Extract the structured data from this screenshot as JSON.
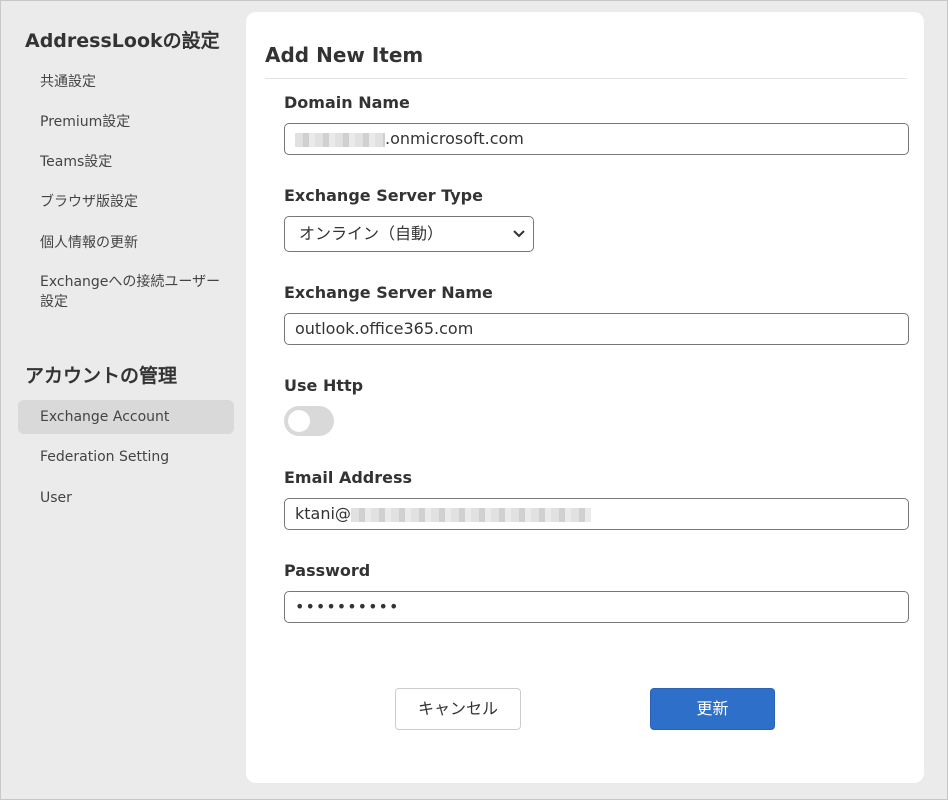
{
  "sidebar": {
    "settings_heading": "AddressLookの設定",
    "settings_items": [
      {
        "label": "共通設定"
      },
      {
        "label": "Premium設定"
      },
      {
        "label": "Teams設定"
      },
      {
        "label": "ブラウザ版設定"
      },
      {
        "label": "個人情報の更新"
      },
      {
        "label": "Exchangeへの接続ユーザー設定"
      }
    ],
    "account_heading": "アカウントの管理",
    "account_items": [
      {
        "label": "Exchange Account",
        "active": true
      },
      {
        "label": "Federation Setting"
      },
      {
        "label": "User"
      }
    ]
  },
  "form": {
    "title": "Add New Item",
    "domain_name": {
      "label": "Domain Name",
      "value_suffix": ".onmicrosoft.com"
    },
    "server_type": {
      "label": "Exchange Server Type",
      "selected": "オンライン（自動）"
    },
    "server_name": {
      "label": "Exchange Server Name",
      "value": "outlook.office365.com"
    },
    "use_http": {
      "label": "Use Http",
      "enabled": false
    },
    "email": {
      "label": "Email Address",
      "value_prefix": "ktani@"
    },
    "password": {
      "label": "Password",
      "masked": "••••••••••"
    },
    "cancel_label": "キャンセル",
    "update_label": "更新"
  },
  "colors": {
    "accent": "#2e6fca",
    "sidebar_active": "#d9d9d9",
    "background": "#ebebeb"
  }
}
